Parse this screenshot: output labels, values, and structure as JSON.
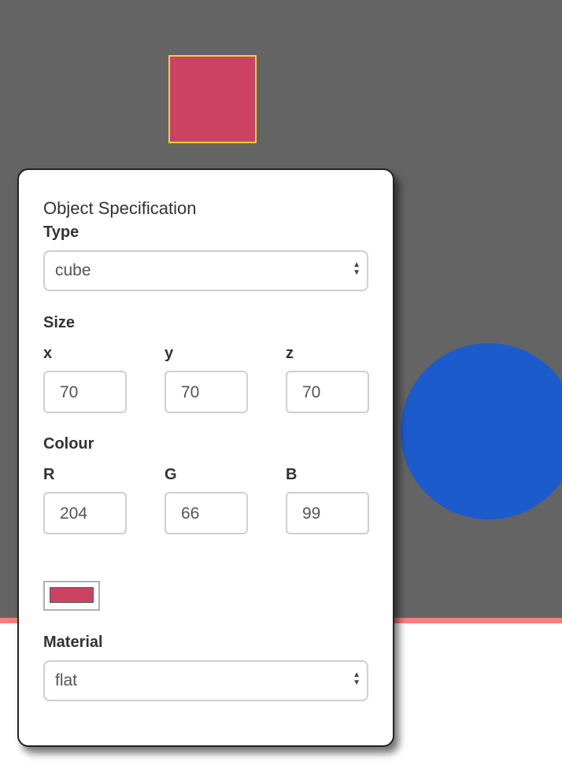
{
  "scene": {
    "background": "#646464",
    "floor_line_color": "#f77f7a",
    "cube_color": "#cc4263",
    "cube_outline_color": "#f1d232",
    "sphere_color": "#1c5bcc"
  },
  "panel": {
    "heading": "Object Specification",
    "type": {
      "label": "Type",
      "value": "cube"
    },
    "size": {
      "label": "Size",
      "x": {
        "label": "x",
        "value": "70"
      },
      "y": {
        "label": "y",
        "value": "70"
      },
      "z": {
        "label": "z",
        "value": "70"
      }
    },
    "colour": {
      "label": "Colour",
      "r": {
        "label": "R",
        "value": "204"
      },
      "g": {
        "label": "G",
        "value": "66"
      },
      "b": {
        "label": "B",
        "value": "99"
      },
      "swatch": "#cc4263"
    },
    "material": {
      "label": "Material",
      "value": "flat"
    }
  }
}
